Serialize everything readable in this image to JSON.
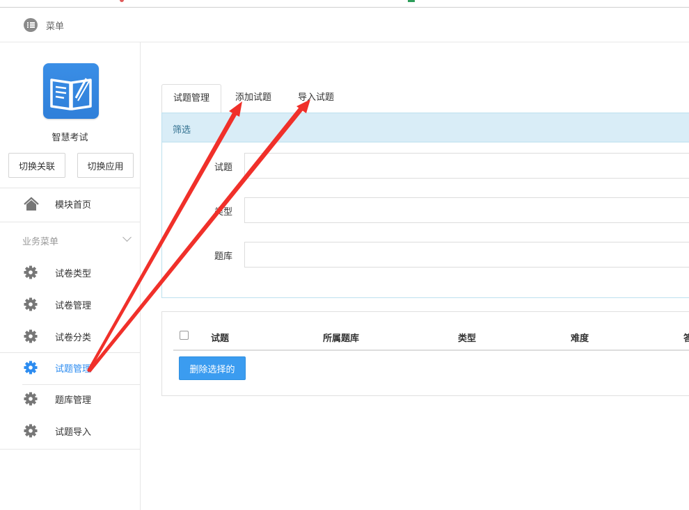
{
  "header": {
    "menu_label": "菜单"
  },
  "sidebar": {
    "app_name": "智慧考试",
    "switch_relation": "切换关联",
    "switch_app": "切换应用",
    "home": "模块首页",
    "section_label": "业务菜单",
    "items": [
      {
        "label": "试卷类型"
      },
      {
        "label": "试卷管理"
      },
      {
        "label": "试卷分类"
      },
      {
        "label": "试题管理"
      },
      {
        "label": "题库管理"
      },
      {
        "label": "试题导入"
      }
    ],
    "active_index": 3
  },
  "tabs": [
    {
      "label": "试题管理"
    },
    {
      "label": "添加试题"
    },
    {
      "label": "导入试题"
    }
  ],
  "filter": {
    "heading": "筛选",
    "fields": [
      {
        "label": "试题",
        "value": ""
      },
      {
        "label": "类型",
        "value": ""
      },
      {
        "label": "题库",
        "value": ""
      }
    ]
  },
  "table": {
    "columns": [
      "试题",
      "所属题库",
      "类型",
      "难度",
      "答"
    ],
    "delete_button": "删除选择的"
  },
  "colors": {
    "accent": "#2d8cf0",
    "annotation_arrow": "#f0302a",
    "panel_header_bg": "#d9edf7"
  }
}
